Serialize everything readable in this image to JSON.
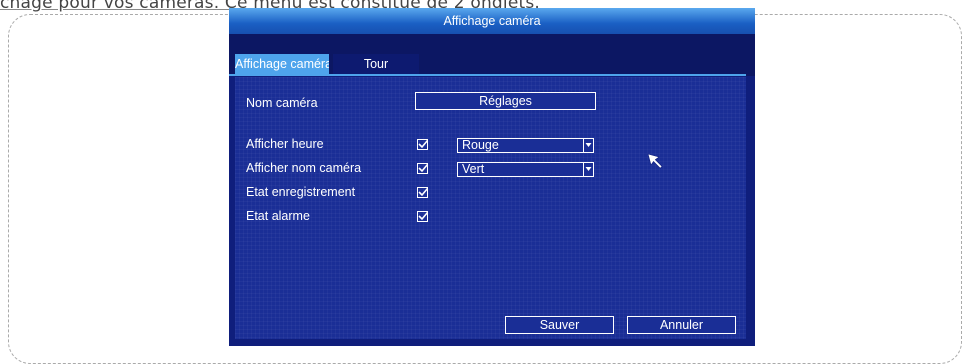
{
  "document": {
    "intro_text": "chage pour vos caméras. Ce menu est constitué de 2 onglets."
  },
  "window": {
    "title": "Affichage caméra"
  },
  "tabs": [
    {
      "label": "Affichage caméra",
      "active": true
    },
    {
      "label": "Tour",
      "active": false
    }
  ],
  "form": {
    "camera_name_label": "Nom caméra",
    "settings_button": "Réglages",
    "rows": [
      {
        "label": "Afficher heure",
        "checked": true,
        "select_value": "Rouge"
      },
      {
        "label": "Afficher nom caméra",
        "checked": true,
        "select_value": "Vert"
      },
      {
        "label": "Etat enregistrement",
        "checked": true
      },
      {
        "label": "Etat alarme",
        "checked": true
      }
    ]
  },
  "buttons": {
    "save": "Sauver",
    "cancel": "Annuler"
  },
  "colors": {
    "titlebar": "#1a5fc4",
    "panel": "#1a2e96",
    "tab_active": "#4ea4ec"
  }
}
